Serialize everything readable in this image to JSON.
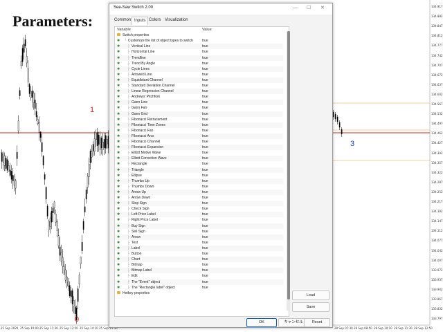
{
  "background_title": "Parameters:",
  "chart": {
    "wave_labels": [
      "1",
      "0",
      "3"
    ],
    "price_labels": [
      "134.917",
      "134.882",
      "134.847",
      "134.812",
      "134.777",
      "134.742",
      "134.707",
      "134.672",
      "134.637",
      "134.602",
      "134.567",
      "134.532",
      "134.497",
      "134.462",
      "134.427",
      "134.392",
      "134.357",
      "134.322",
      "134.287",
      "134.252",
      "134.217",
      "134.182",
      "134.147",
      "134.112",
      "134.077",
      "134.042",
      "134.007",
      "133.972",
      "133.937",
      "133.902",
      "133.867",
      "133.832",
      "133.797"
    ],
    "time_labels": [
      "25 Sep 2020",
      "25 Sep 10:00",
      "25 Sep 11:30",
      "25 Sep 12:50",
      "25 Sep 14:10",
      "25 Sep 15:30",
      "28 Sep 07:30",
      "28 Sep 08:50",
      "28 Sep 10:10",
      "28 Sep 11:30",
      "28 Sep 12:50"
    ],
    "colors": {
      "red_line": "#d9261c",
      "orange_line": "#e6a23c",
      "candle": "#000000",
      "wave_red": "#d9261c",
      "wave_blue": "#1a3fd6"
    }
  },
  "dialog": {
    "title": "See-Saw Switch 2.00",
    "window_buttons": [
      "—",
      "☐",
      "✕"
    ],
    "tabs": [
      "Common",
      "Inputs",
      "Colors",
      "Visualization"
    ],
    "active_tab": "Inputs",
    "columns": {
      "variable": "Variable",
      "value": "Value"
    },
    "group_header": "Switch properties",
    "customize_label": "Customize the list of object types to switch",
    "rows": [
      {
        "label": "Customize the list of object types to switch",
        "value": "true"
      },
      {
        "label": "Vertical Line",
        "value": "true"
      },
      {
        "label": "Horizontal Line",
        "value": "true"
      },
      {
        "label": "Trendline",
        "value": "true"
      },
      {
        "label": "Trend By Angle",
        "value": "true"
      },
      {
        "label": "Cycle Lines",
        "value": "true"
      },
      {
        "label": "Arrowed Line",
        "value": "true"
      },
      {
        "label": "Equidistant Channel",
        "value": "true"
      },
      {
        "label": "Standard Deviation Channel",
        "value": "true"
      },
      {
        "label": "Linear Regression Channel",
        "value": "true"
      },
      {
        "label": "Andrews' Pitchfork",
        "value": "true"
      },
      {
        "label": "Gann Line",
        "value": "true"
      },
      {
        "label": "Gann Fan",
        "value": "true"
      },
      {
        "label": "Gann Grid",
        "value": "true"
      },
      {
        "label": "Fibonacci Retracement",
        "value": "true"
      },
      {
        "label": "Fibonacci Time Zones",
        "value": "true"
      },
      {
        "label": "Fibonacci Fan",
        "value": "true"
      },
      {
        "label": "Fibonacci Arcs",
        "value": "true"
      },
      {
        "label": "Fibonacci Channel",
        "value": "true"
      },
      {
        "label": "Fibonacci Expansion",
        "value": "true"
      },
      {
        "label": "Elliott Motive Wave",
        "value": "true"
      },
      {
        "label": "Elliott Correction Wave",
        "value": "true"
      },
      {
        "label": "Rectangle",
        "value": "true"
      },
      {
        "label": "Triangle",
        "value": "true"
      },
      {
        "label": "Ellipse",
        "value": "true"
      },
      {
        "label": "Thumbs Up",
        "value": "true"
      },
      {
        "label": "Thumbs Down",
        "value": "true"
      },
      {
        "label": "Arrow Up",
        "value": "true"
      },
      {
        "label": "Arrow Down",
        "value": "true"
      },
      {
        "label": "Stop Sign",
        "value": "true"
      },
      {
        "label": "Check Sign",
        "value": "true"
      },
      {
        "label": "Left Price Label",
        "value": "true"
      },
      {
        "label": "Right Price Label",
        "value": "true"
      },
      {
        "label": "Buy Sign",
        "value": "true"
      },
      {
        "label": "Sell Sign",
        "value": "true"
      },
      {
        "label": "Arrow",
        "value": "true"
      },
      {
        "label": "Text",
        "value": "true"
      },
      {
        "label": "Label",
        "value": "true"
      },
      {
        "label": "Button",
        "value": "true"
      },
      {
        "label": "Chart",
        "value": "true"
      },
      {
        "label": "Bitmap",
        "value": "true"
      },
      {
        "label": "Bitmap Label",
        "value": "true"
      },
      {
        "label": "Edit",
        "value": "true"
      },
      {
        "label": "The \"Event\" object",
        "value": "true"
      },
      {
        "label": "The \"Rectangle label\" object",
        "value": "true"
      }
    ],
    "hotkey_group": "Hotkey properties",
    "side_buttons": {
      "load": "Load",
      "save": "Save"
    },
    "footer_buttons": {
      "ok": "OK",
      "cancel": "キャンセル",
      "reset": "Reset"
    }
  }
}
